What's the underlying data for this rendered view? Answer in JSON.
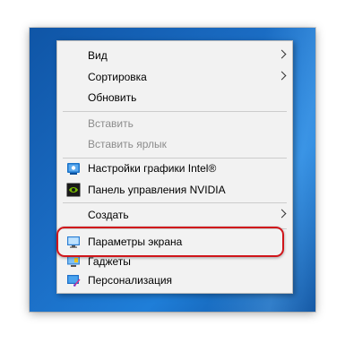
{
  "context_menu": {
    "items": [
      {
        "label": "Вид",
        "has_submenu": true,
        "enabled": true,
        "icon": null
      },
      {
        "label": "Сортировка",
        "has_submenu": true,
        "enabled": true,
        "icon": null
      },
      {
        "label": "Обновить",
        "has_submenu": false,
        "enabled": true,
        "icon": null
      },
      {
        "label": "Вставить",
        "has_submenu": false,
        "enabled": false,
        "icon": null
      },
      {
        "label": "Вставить ярлык",
        "has_submenu": false,
        "enabled": false,
        "icon": null
      },
      {
        "label": "Настройки графики Intel®",
        "has_submenu": false,
        "enabled": true,
        "icon": "intel-graphics-icon"
      },
      {
        "label": "Панель управления NVIDIA",
        "has_submenu": false,
        "enabled": true,
        "icon": "nvidia-icon"
      },
      {
        "label": "Создать",
        "has_submenu": true,
        "enabled": true,
        "icon": null
      },
      {
        "label": "Параметры экрана",
        "has_submenu": false,
        "enabled": true,
        "icon": "display-icon",
        "highlighted": true
      },
      {
        "label": "Гаджеты",
        "has_submenu": false,
        "enabled": true,
        "icon": "gadgets-icon"
      },
      {
        "label": "Персонализация",
        "has_submenu": false,
        "enabled": true,
        "icon": "personalization-icon"
      }
    ]
  },
  "colors": {
    "desktop_background": "#1a6bc2",
    "menu_background": "#f2f2f2",
    "highlight_outline": "#d0161b",
    "disabled_text": "#8c8c8c"
  }
}
